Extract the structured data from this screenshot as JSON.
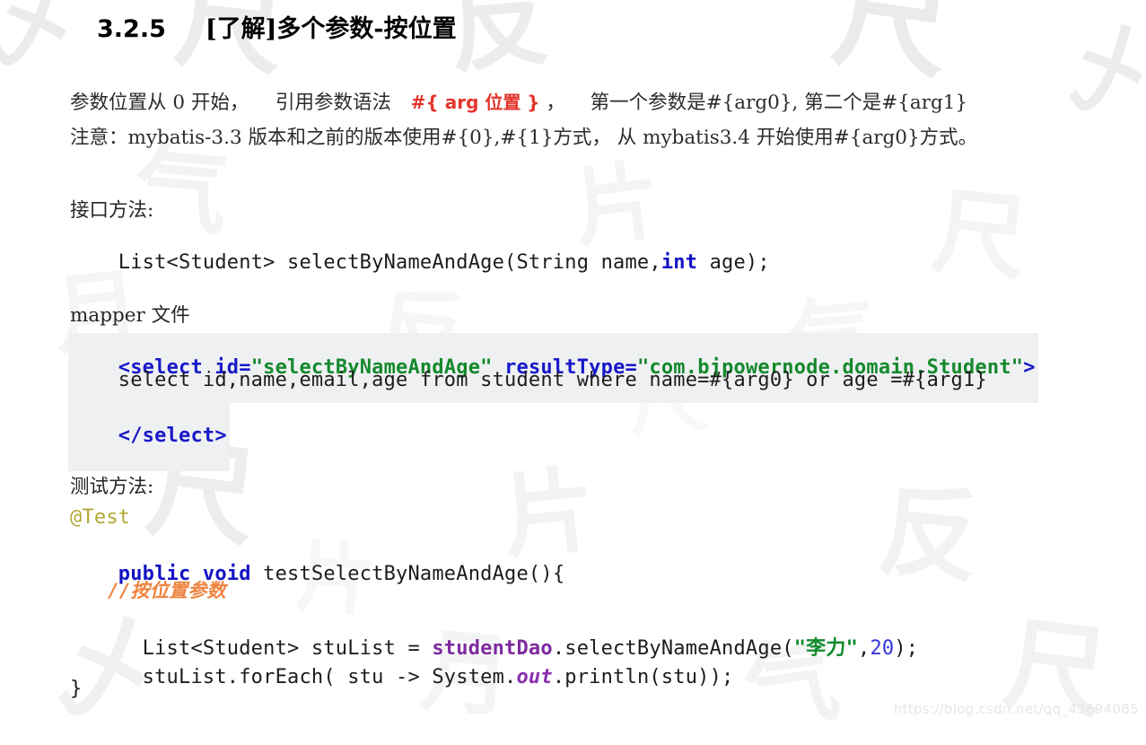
{
  "document": {
    "heading": {
      "number": "3.2.5",
      "title": "[了解]多个参数-按位置"
    },
    "intro": {
      "line1_part1": "参数位置从 0 开始，",
      "line1_part2": "引用参数语法",
      "line1_highlight": "#{ arg 位置 }",
      "line1_part3": "，",
      "line1_part4": "第一个参数是#{arg0}, 第二个是#{arg1}",
      "line2": "注意：mybatis-3.3 版本和之前的版本使用#{0},#{1}方式， 从 mybatis3.4 开始使用#{arg0}方式。"
    },
    "interface_section": {
      "caption": "接口方法:",
      "code": {
        "before_keyword": "List<Student> selectByNameAndAge(String name,",
        "keyword": "int",
        "after_keyword": " age);"
      }
    },
    "mapper_section": {
      "caption": "mapper 文件",
      "open_tag": {
        "lt": "<",
        "tag": "select",
        "space": " ",
        "attr1_name": "id=",
        "attr1_value": "\"selectByNameAndAge\"",
        "gap": " ",
        "attr2_name": "resultType=",
        "attr2_value": "\"com.bjpowernode.domain.Student\"",
        "gt": ">"
      },
      "sql_line": "    select id,name,email,age from student where name=#{arg0} or age =#{arg1}",
      "close_tag": {
        "lt": "</",
        "tag": "select",
        "gt": ">"
      }
    },
    "test_section": {
      "caption": "测试方法:",
      "annotation": "@Test",
      "signature": {
        "modifier": "public void",
        "rest": " testSelectByNameAndAge(){"
      },
      "comment": "//按位置参数",
      "call_line": {
        "prefix": "  List<Student> stuList = ",
        "field": "studentDao",
        "method": ".selectByNameAndAge(",
        "string_arg": "\"李力\"",
        "comma": ",",
        "number_arg": "20",
        "suffix": ");"
      },
      "foreach_line": {
        "prefix": "  stuList.forEach( stu -> System.",
        "field": "out",
        "suffix": ".println(stu));"
      },
      "closing_brace": "}"
    },
    "watermark": {
      "csdn_url": "https://blog.csdn.net/qq_43694085",
      "strokes": [
        "片",
        "气",
        "尺",
        "反",
        "月",
        "元",
        "气",
        "尺",
        "片",
        "反",
        "月",
        "尺",
        "气",
        "片",
        "尺",
        "反",
        "月",
        "气",
        "尺",
        "片"
      ]
    },
    "colors": {
      "keyword_blue": "#1313c4",
      "tag_blue": "#1818c8",
      "value_green": "#14892c",
      "highlight_red": "#e4342b",
      "annotation_olive": "#b3a833",
      "comment_orange": "#ef8340",
      "field_purple": "#7d2a9e",
      "code_highlight_bg": "#eff0f2"
    }
  }
}
